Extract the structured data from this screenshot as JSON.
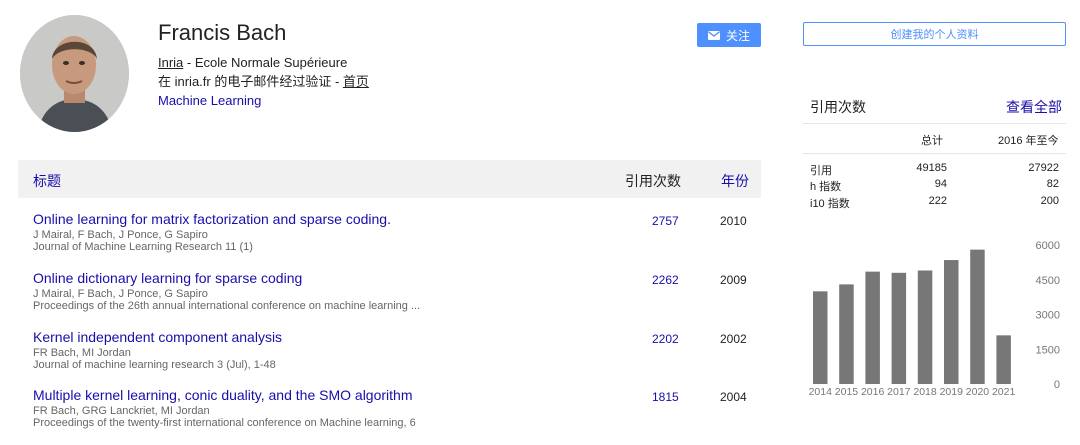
{
  "profile": {
    "name": "Francis Bach",
    "affiliation_link": "Inria",
    "affiliation_rest": " - Ecole Normale Supérieure",
    "verified_prefix": "在 inria.fr 的电子邮件经过验证 - ",
    "homepage": "首页",
    "interest": "Machine Learning",
    "follow_label": "关注"
  },
  "table": {
    "col_title": "标题",
    "col_cites": "引用次数",
    "col_year": "年份",
    "rows": [
      {
        "title": "Online learning for matrix factorization and sparse coding.",
        "authors": "J Mairal, F Bach, J Ponce, G Sapiro",
        "venue": "Journal of Machine Learning Research 11 (1)",
        "cites": "2757",
        "year": "2010"
      },
      {
        "title": "Online dictionary learning for sparse coding",
        "authors": "J Mairal, F Bach, J Ponce, G Sapiro",
        "venue": "Proceedings of the 26th annual international conference on machine learning ...",
        "cites": "2262",
        "year": "2009"
      },
      {
        "title": "Kernel independent component analysis",
        "authors": "FR Bach, MI Jordan",
        "venue": "Journal of machine learning research 3 (Jul), 1-48",
        "cites": "2202",
        "year": "2002"
      },
      {
        "title": "Multiple kernel learning, conic duality, and the SMO algorithm",
        "authors": "FR Bach, GRG Lanckriet, MI Jordan",
        "venue": "Proceedings of the twenty-first international conference on Machine learning, 6",
        "cites": "1815",
        "year": "2004"
      }
    ]
  },
  "sidebar": {
    "create_profile": "创建我的个人资料",
    "cited_by": "引用次数",
    "view_all": "查看全部",
    "col_all": "总计",
    "col_since": "2016 年至今",
    "stats": [
      {
        "label": "引用",
        "all": "49185",
        "since": "27922"
      },
      {
        "label": "h 指数",
        "all": "94",
        "since": "82"
      },
      {
        "label": "i10 指数",
        "all": "222",
        "since": "200"
      }
    ]
  },
  "chart_data": {
    "type": "bar",
    "categories": [
      "2014",
      "2015",
      "2016",
      "2017",
      "2018",
      "2019",
      "2020",
      "2021"
    ],
    "values": [
      4000,
      4300,
      4850,
      4800,
      4900,
      5350,
      5800,
      2100
    ],
    "y_ticks": [
      "6000",
      "4500",
      "3000",
      "1500",
      "0"
    ],
    "ylim": [
      0,
      6000
    ],
    "bar_color": "#777777"
  }
}
